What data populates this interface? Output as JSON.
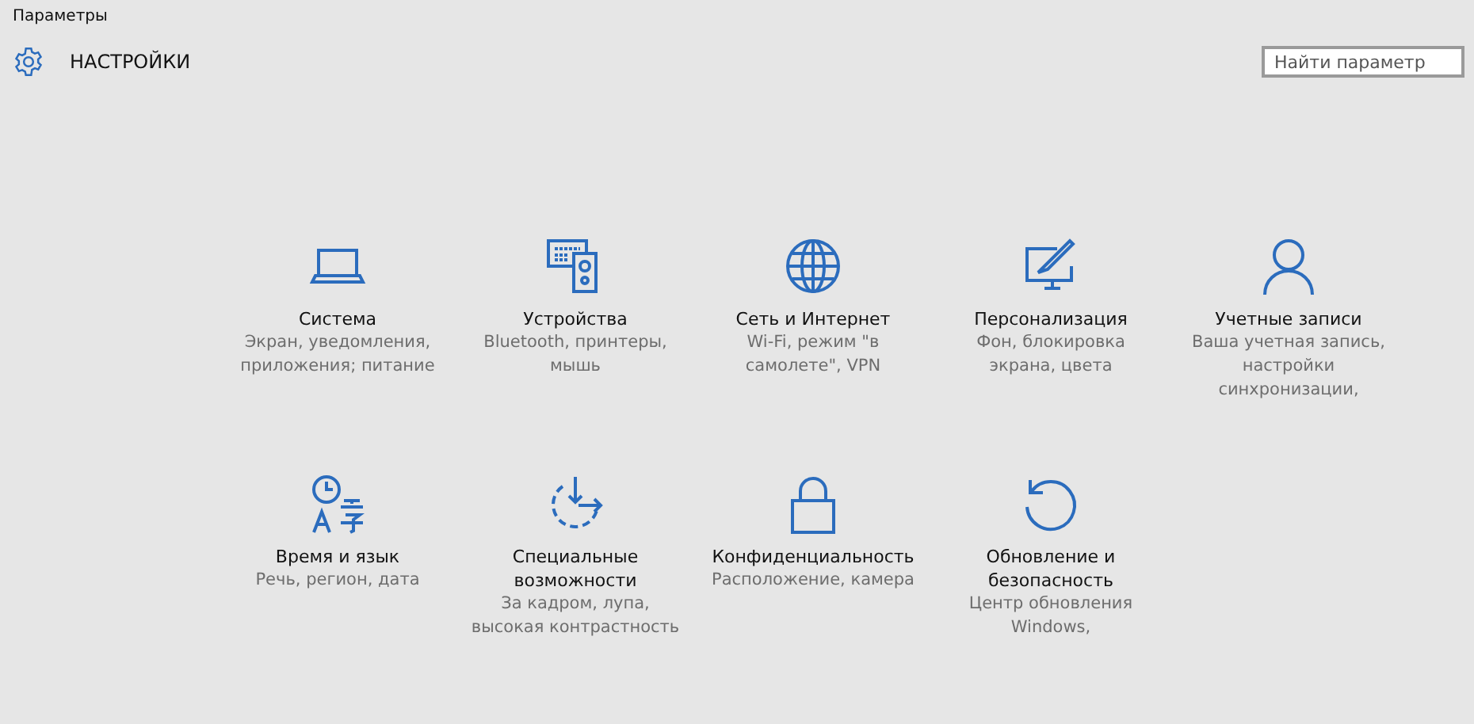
{
  "window": {
    "title": "Параметры"
  },
  "header": {
    "title": "НАСТРОЙКИ"
  },
  "search": {
    "placeholder": "Найти параметр"
  },
  "tiles": [
    {
      "kind": "laptop",
      "title": "Система",
      "description": "Экран, уведомления,\nприложения; питание"
    },
    {
      "kind": "devices",
      "title": "Устройства",
      "description": "Bluetooth, принтеры,\nмышь"
    },
    {
      "kind": "globe",
      "title": "Сеть и Интернет",
      "description": "Wi-Fi, режим \"в\nсамолете\", VPN"
    },
    {
      "kind": "paint",
      "title": "Персонализация",
      "description": "Фон, блокировка\nэкрана, цвета"
    },
    {
      "kind": "person",
      "title": "Учетные записи",
      "description": "Ваша учетная запись,\nнастройки\nсинхронизации,"
    },
    {
      "kind": "language",
      "title": "Время и язык",
      "description": "Речь, регион, дата"
    },
    {
      "kind": "access",
      "title": "Специальные\nвозможности",
      "description": "За кадром, лупа,\nвысокая контрастность"
    },
    {
      "kind": "lock",
      "title": "Конфиденциальность",
      "description": "Расположение, камера"
    },
    {
      "kind": "update",
      "title": "Обновление и\nбезопасность",
      "description": "Центр обновления\nWindows,"
    }
  ]
}
